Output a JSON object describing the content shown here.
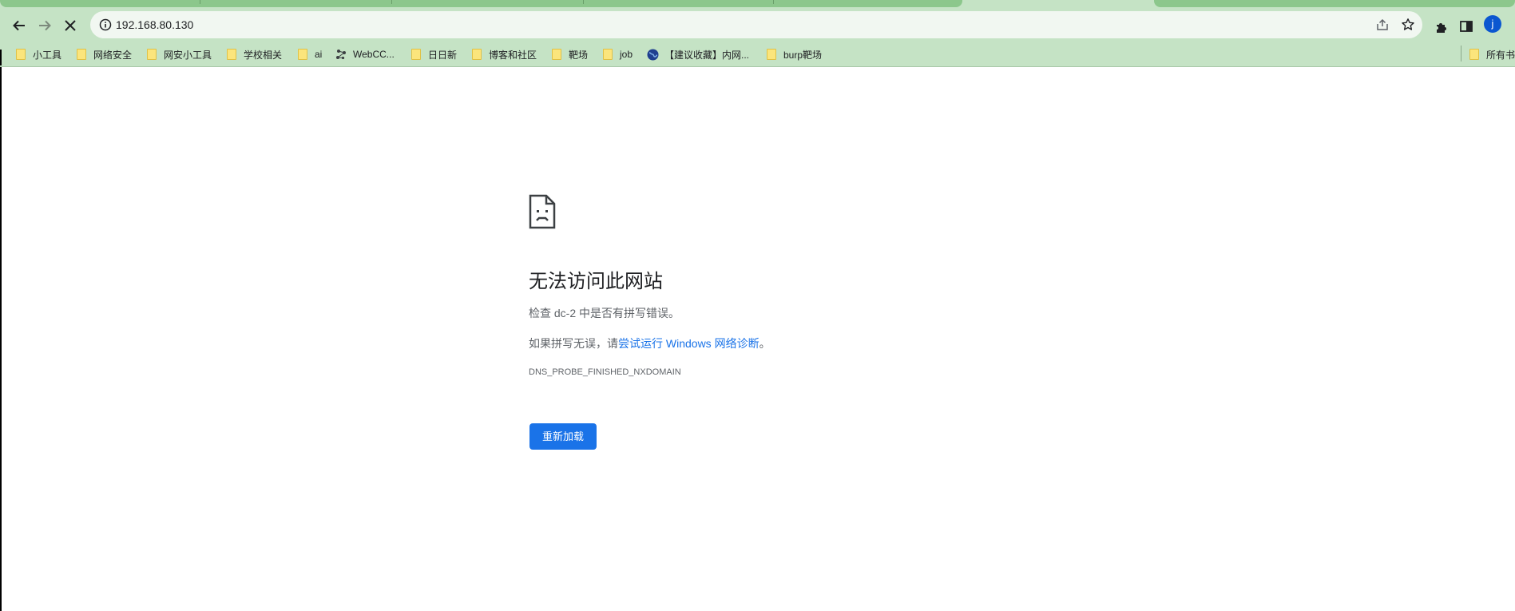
{
  "address_bar": {
    "url": "192.168.80.130"
  },
  "bookmarks": [
    {
      "label": "小工具",
      "icon": "folder-icon"
    },
    {
      "label": "网络安全",
      "icon": "folder-icon"
    },
    {
      "label": "网安小工具",
      "icon": "folder-icon"
    },
    {
      "label": "学校相关",
      "icon": "folder-icon"
    },
    {
      "label": "ai",
      "icon": "folder-icon"
    },
    {
      "label": "WebCC...",
      "icon": "webcc-icon"
    },
    {
      "label": "日日新",
      "icon": "folder-icon"
    },
    {
      "label": "博客和社区",
      "icon": "folder-icon"
    },
    {
      "label": "靶场",
      "icon": "folder-icon"
    },
    {
      "label": "job",
      "icon": "folder-icon"
    },
    {
      "label": "【建议收藏】内网...",
      "icon": "globe-icon"
    },
    {
      "label": "burp靶场",
      "icon": "folder-icon"
    }
  ],
  "other_bookmarks": {
    "label": "所有书",
    "icon": "folder-icon"
  },
  "profile": {
    "initial": "j",
    "color": "#0b57d0"
  },
  "error_page": {
    "icon": "sad-page-icon",
    "title": "无法访问此网站",
    "line1": "检查 dc-2 中是否有拼写错误。",
    "line2_prefix": "如果拼写无误，请",
    "line2_link": "尝试运行 Windows 网络诊断",
    "line2_suffix": "。",
    "error_code": "DNS_PROBE_FINISHED_NXDOMAIN",
    "reload_button": "重新加载"
  },
  "colors": {
    "toolbar_bg": "#c5e3c5",
    "accent_blue": "#1a73e8"
  }
}
